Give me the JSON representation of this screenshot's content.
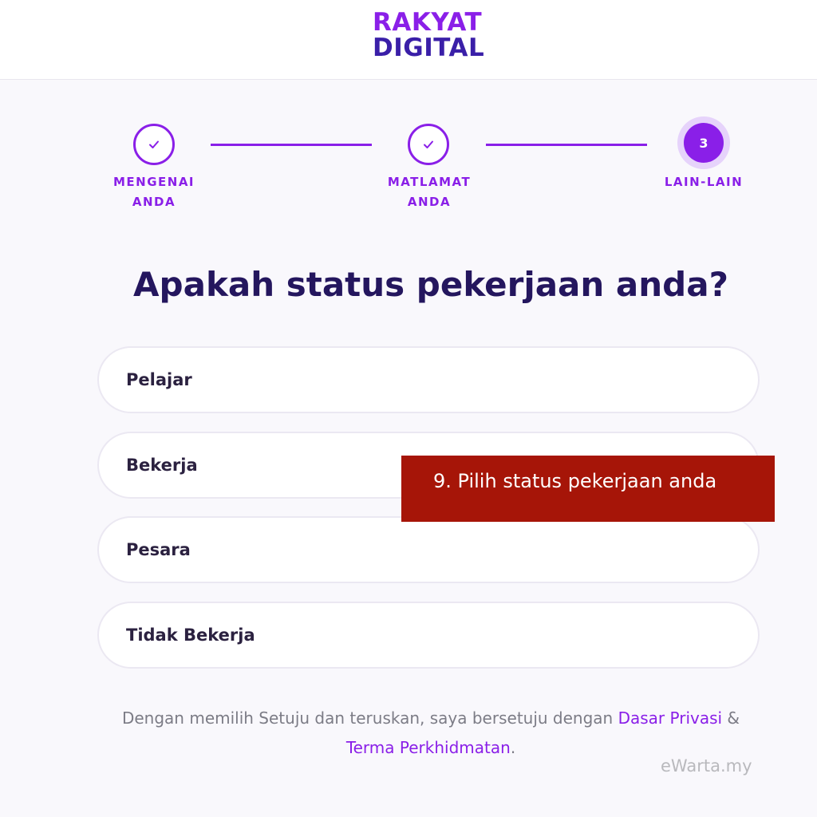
{
  "header": {
    "logo_line1": "RAKYAT",
    "logo_line2": "DIGITAL"
  },
  "stepper": {
    "steps": [
      {
        "label_line1": "MENGENAI",
        "label_line2": "ANDA",
        "state": "done"
      },
      {
        "label_line1": "MATLAMAT",
        "label_line2": "ANDA",
        "state": "done"
      },
      {
        "label_line1": "LAIN-LAIN",
        "label_line2": "",
        "number": "3",
        "state": "current"
      }
    ]
  },
  "question": "Apakah status pekerjaan anda?",
  "options": [
    "Pelajar",
    "Bekerja",
    "Pesara",
    "Tidak Bekerja"
  ],
  "callout": "9. Pilih status pekerjaan anda",
  "footer": {
    "text_before": "Dengan memilih Setuju dan teruskan, saya bersetuju dengan ",
    "privacy_link": "Dasar Privasi",
    "amp": " &",
    "terms_link": "Terma Perkhidmatan",
    "period": "."
  },
  "watermark": "eWarta.my",
  "colors": {
    "accent": "#8a1fe8",
    "heading": "#24165e",
    "callout_bg": "#a61508"
  }
}
